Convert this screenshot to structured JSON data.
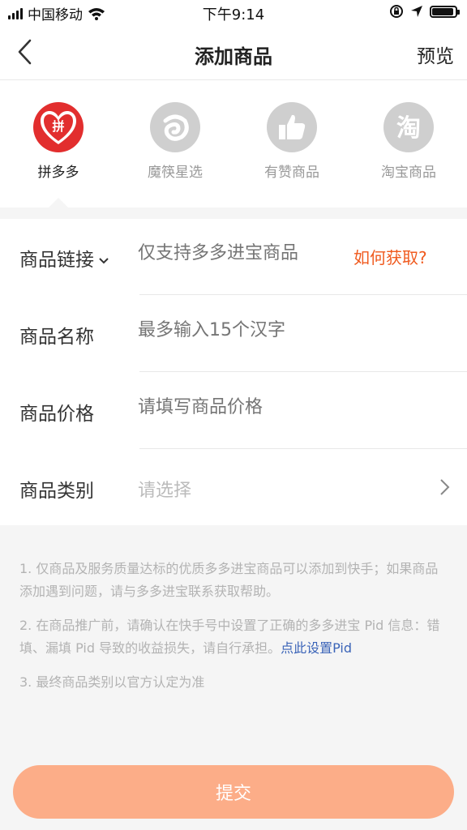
{
  "status": {
    "carrier": "中国移动",
    "time": "下午9:14"
  },
  "nav": {
    "title": "添加商品",
    "preview": "预览"
  },
  "platforms": [
    {
      "name": "拼多多",
      "icon": "pinduoduo-logo",
      "active": true
    },
    {
      "name": "魔筷星选",
      "icon": "mokuai-logo",
      "active": false
    },
    {
      "name": "有赞商品",
      "icon": "thumbs-up-icon",
      "active": false
    },
    {
      "name": "淘宝商品",
      "icon": "taobao-logo",
      "active": false
    }
  ],
  "logo_glyphs": {
    "pinduoduo": "拼",
    "taobao": "淘"
  },
  "form": {
    "link_label": "商品链接",
    "link_placeholder": "仅支持多多进宝商品",
    "howto": "如何获取?",
    "name_label": "商品名称",
    "name_placeholder": "最多输入15个汉字",
    "price_label": "商品价格",
    "price_placeholder": "请填写商品价格",
    "category_label": "商品类别",
    "category_placeholder": "请选择"
  },
  "notes": {
    "note1": "1. 仅商品及服务质量达标的优质多多进宝商品可以添加到快手；如果商品添加遇到问题，请与多多进宝联系获取帮助。",
    "note2": "2. 在商品推广前，请确认在快手号中设置了正确的多多进宝 Pid 信息：错填、漏填 Pid 导致的收益损失，请自行承担。",
    "note2_link": "点此设置Pid",
    "note3": "3. 最终商品类别以官方认定为准"
  },
  "submit": "提交",
  "colors": {
    "accent": "#f05a1e",
    "submit_bg": "#fcad88",
    "pdd_red": "#e22e2e",
    "link_blue": "#3b64b8"
  }
}
